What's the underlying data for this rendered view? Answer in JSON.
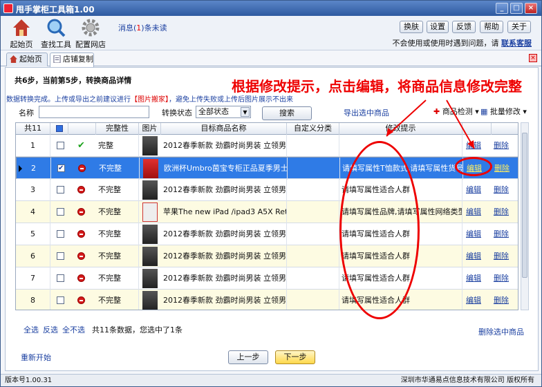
{
  "window": {
    "title": "甩手掌柜工具箱1.00",
    "controls": [
      "_",
      "□",
      "×"
    ]
  },
  "toolbar": {
    "items": [
      {
        "label": "起始页",
        "icon": "house-icon"
      },
      {
        "label": "查找工具",
        "icon": "magnifier-icon"
      },
      {
        "label": "配置网店",
        "icon": "gear-icon"
      }
    ],
    "message_prefix": "消息(",
    "message_count": "1",
    "message_suffix": ")条未读",
    "buttons": [
      "换肤",
      "设置",
      "反馈",
      "帮助",
      "关于"
    ],
    "help_text": "不会使用或使用时遇到问题，请",
    "help_link": "联系客服"
  },
  "tabs": [
    {
      "label": "起始页",
      "icon": "house-icon"
    },
    {
      "label": "店铺复制",
      "icon": "page-icon",
      "active": true
    }
  ],
  "step_title": "共6步，当前第5步，转换商品详情",
  "note": {
    "prefix": "数据转换完成。上传或导出之前建议进行",
    "highlight": "【图片搬家】",
    "suffix": "，避免上传失败或上传后图片展示不出来"
  },
  "annotation": "根据修改提示，点击编辑，将商品信息修改完整",
  "filters": {
    "name_label": "名称",
    "name_value": "",
    "status_label": "转换状态",
    "status_value": "全部状态",
    "search_button": "搜索",
    "export_link": "导出选中商品",
    "check_button": "商品检测",
    "batch_button": "批量修改"
  },
  "grid": {
    "headers": [
      "共11",
      "",
      "",
      "完整性",
      "图片",
      "目标商品名称",
      "自定义分类",
      "修改提示",
      "",
      ""
    ],
    "edit_label": "编辑",
    "delete_label": "删除",
    "rows": [
      {
        "num": "1",
        "checked": false,
        "status": "ok",
        "integrity": "完整",
        "thumb": "dark",
        "name": "2012春季新款 劲霸时尚男装 立领男...",
        "category": "",
        "hint": "",
        "selected": false,
        "yellow": false
      },
      {
        "num": "2",
        "checked": true,
        "status": "err",
        "integrity": "不完整",
        "thumb": "red",
        "name": "欧洲杯Umbro茵宝专柜正品夏季男士...",
        "category": "",
        "hint": "请填写属性T恤款式,请填写属性货号",
        "selected": true,
        "yellow": false
      },
      {
        "num": "3",
        "checked": false,
        "status": "err",
        "integrity": "不完整",
        "thumb": "dark",
        "name": "2012春季新款 劲霸时尚男装 立领男...",
        "category": "",
        "hint": "请填写属性适合人群",
        "selected": false,
        "yellow": false
      },
      {
        "num": "4",
        "checked": false,
        "status": "err",
        "integrity": "不完整",
        "thumb": "ipad",
        "name": "苹果The new iPad /ipad3 A5X Retina...",
        "category": "",
        "hint": "请填写属性品牌,请填写属性网络类型,",
        "selected": false,
        "yellow": true
      },
      {
        "num": "5",
        "checked": false,
        "status": "err",
        "integrity": "不完整",
        "thumb": "dark",
        "name": "2012春季新款 劲霸时尚男装 立领男...",
        "category": "",
        "hint": "请填写属性适合人群",
        "selected": false,
        "yellow": false
      },
      {
        "num": "6",
        "checked": false,
        "status": "err",
        "integrity": "不完整",
        "thumb": "dark",
        "name": "2012春季新款 劲霸时尚男装 立领男...",
        "category": "",
        "hint": "请填写属性适合人群",
        "selected": false,
        "yellow": true
      },
      {
        "num": "7",
        "checked": false,
        "status": "err",
        "integrity": "不完整",
        "thumb": "dark",
        "name": "2012春季新款 劲霸时尚男装 立领男...",
        "category": "",
        "hint": "请填写属性适合人群",
        "selected": false,
        "yellow": false
      },
      {
        "num": "8",
        "checked": false,
        "status": "err",
        "integrity": "不完整",
        "thumb": "dark",
        "name": "2012春季新款 劲霸时尚男装 立领男...",
        "category": "",
        "hint": "请填写属性适合人群",
        "selected": false,
        "yellow": true
      }
    ]
  },
  "footer": {
    "select_all": "全选",
    "invert": "反选",
    "select_none": "全不选",
    "summary": "共11条数据，您选中了1条",
    "delete_selected": "删除选中商品",
    "restart": "重新开始",
    "prev": "上一步",
    "next": "下一步"
  },
  "status_bar": {
    "version": "版本号1.00.31",
    "company": "深圳市华通易点信息技术有限公司 版权所有"
  }
}
